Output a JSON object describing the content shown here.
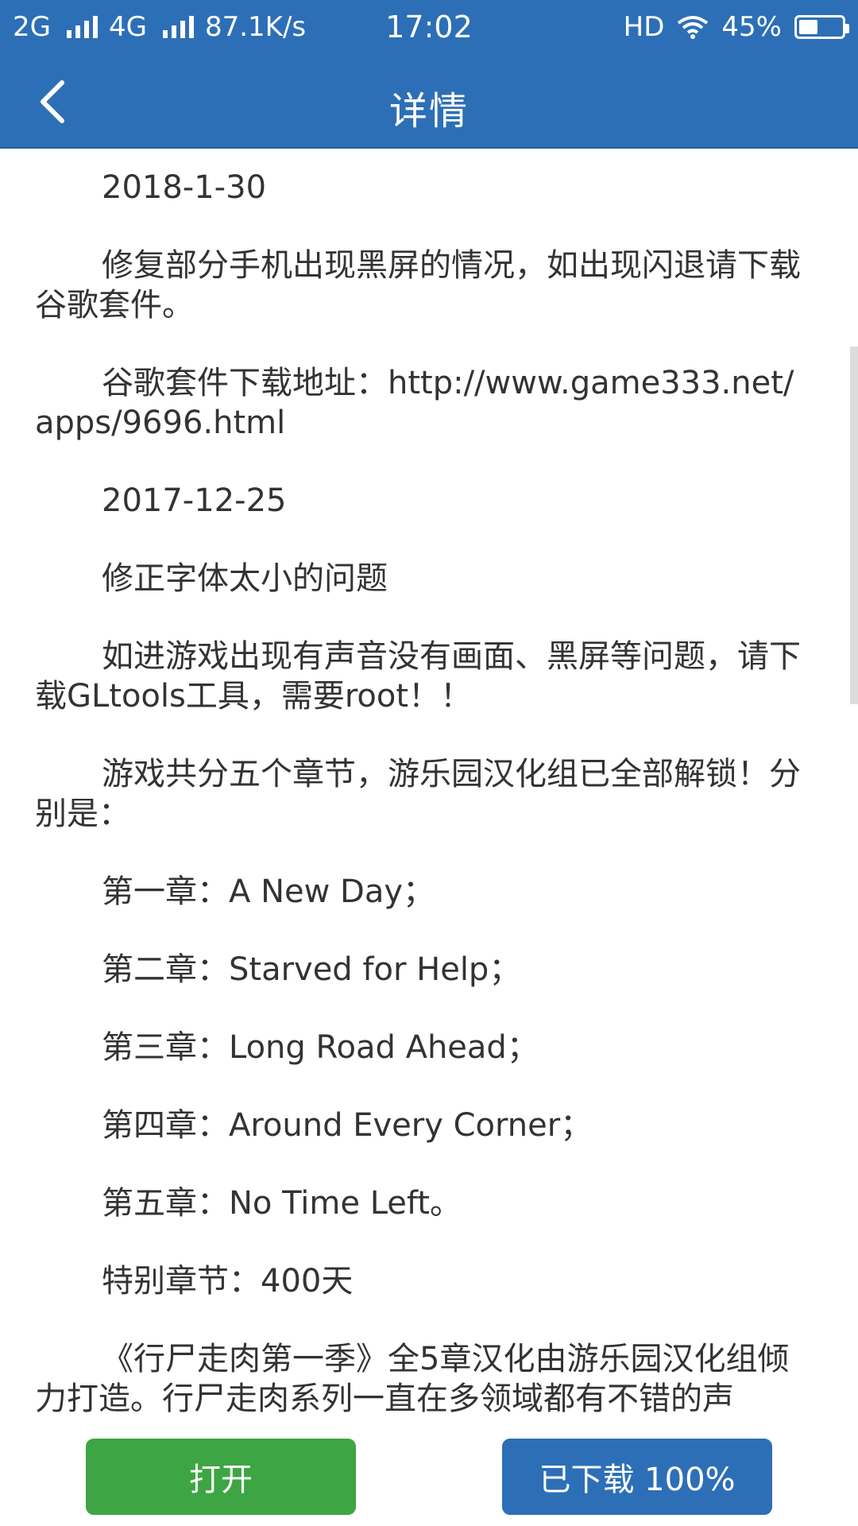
{
  "status_bar": {
    "network1": "2G",
    "network2": "4G",
    "speed": "87.1K/s",
    "time": "17:02",
    "hd": "HD",
    "battery": "45%",
    "battery_level": 0.45
  },
  "header": {
    "title": "详情",
    "back_icon": "chevron-left-icon"
  },
  "content": {
    "paragraphs": [
      "2018-1-30",
      "修复部分手机出现黑屏的情况，如出现闪退请下载谷歌套件。",
      "谷歌套件下载地址：http://www.game333.net/apps/9696.html",
      "2017-12-25",
      "修正字体太小的问题",
      "如进游戏出现有声音没有画面、黑屏等问题，请下载GLtools工具，需要root！！",
      "游戏共分五个章节，游乐园汉化组已全部解锁！分别是：",
      "第一章：A New Day；",
      "第二章：Starved for Help；",
      "第三章：Long Road Ahead；",
      "第四章：Around Every Corner；",
      "第五章：No Time Left。",
      "特别章节：400天",
      "《行尸走肉第一季》全5章汉化由游乐园汉化组倾力打造。行尸走肉系列一直在多领域都有不错的声"
    ]
  },
  "actions": {
    "open_label": "打开",
    "download_label": "已下载 100%"
  },
  "colors": {
    "header": "#2d6fb6",
    "open_button": "#3ea544",
    "download_button": "#2d6fb6"
  }
}
